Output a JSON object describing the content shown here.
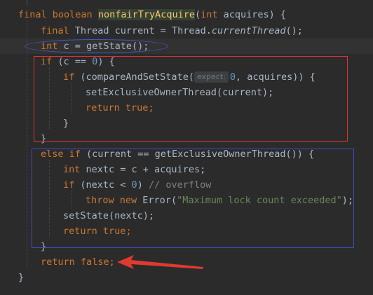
{
  "code": {
    "line1": {
      "kw_final": "final",
      "kw_boolean": "boolean",
      "method_name": "nonfairTryAcquire",
      "paren_open": "(",
      "kw_int": "int",
      "params_rest": " acquires) {"
    },
    "line2": {
      "kw_final": "final",
      "text_decl": " Thread current = Thread.",
      "static_call": "currentThread",
      "text_end": "();"
    },
    "line3": {
      "kw_int": "int",
      "text": " c = getState();"
    },
    "line4": {
      "kw_if": "if",
      "text_a": " (c == ",
      "num_zero": "0",
      "text_b": ") {"
    },
    "line5": {
      "kw_if": "if",
      "text_a": " (compareAndSetState(",
      "hint": "expect:",
      "num_zero": "0",
      "text_b": ", acquires)) {"
    },
    "line6": {
      "text": "setExclusiveOwnerThread(current);"
    },
    "line7": {
      "kw_return": "return",
      "kw_true": "true",
      "semi": ";"
    },
    "line8": {
      "brace": "}"
    },
    "line9": {
      "brace": "}"
    },
    "line10": {
      "kw_else": "else",
      "kw_if": "if",
      "text": " (current == getExclusiveOwnerThread()) {"
    },
    "line11": {
      "kw_int": "int",
      "text": " nextc = c + acquires;"
    },
    "line12": {
      "kw_if": "if",
      "text_a": " (nextc < ",
      "num_zero": "0",
      "text_b": ") ",
      "comment": "// overflow"
    },
    "line13": {
      "kw_throw": "throw",
      "kw_new": "new",
      "text_a": " Error(",
      "string": "\"Maximum lock count exceeded\"",
      "text_b": ");"
    },
    "line14": {
      "text": "setState(nextc);"
    },
    "line15": {
      "kw_return": "return",
      "kw_true": "true",
      "semi": ";"
    },
    "line16": {
      "brace": "}"
    },
    "line17": {
      "kw_return": "return",
      "kw_false": "false",
      "semi": ";"
    },
    "line18": {
      "brace": "}"
    }
  },
  "colors": {
    "background": "#2b2b2b",
    "keyword": "#cc7832",
    "method_declaration": "#ffc66d",
    "number": "#6897bb",
    "string": "#6a8759",
    "comment": "#808080",
    "annotation_red": "#d9352f",
    "annotation_blue": "#3f4cc8"
  }
}
